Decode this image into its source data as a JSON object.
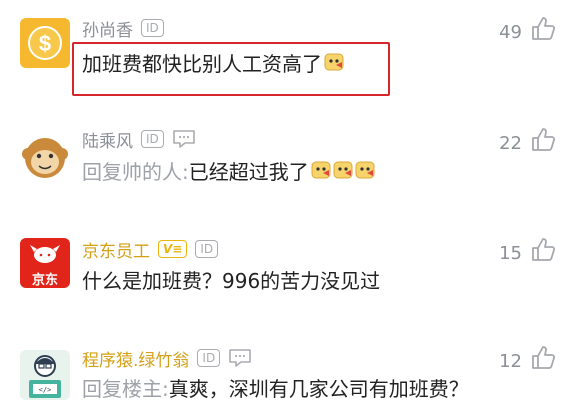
{
  "comments": [
    {
      "username": "孙尚香",
      "id_badge": "ID",
      "text": "加班费都快比别人工资高了",
      "emoji_count": 1,
      "likes": "49",
      "avatar": "dollar-coin-avatar"
    },
    {
      "username": "陆乘风",
      "id_badge": "ID",
      "reply_prefix": "回复帅的人:",
      "text": "已经超过我了",
      "emoji_count": 3,
      "likes": "22",
      "avatar": "monkey-avatar"
    },
    {
      "username": "京东员工",
      "id_badge": "ID",
      "vip_badge": "V≡",
      "text": "什么是加班费？996的苦力没见过",
      "likes": "15",
      "avatar": "jd-logo-avatar",
      "avatar_text": "京东"
    },
    {
      "username": "程序猿.绿竹翁",
      "id_badge": "ID",
      "reply_prefix": "回复楼主:",
      "text": "真爽，深圳有几家公司有加班费？",
      "likes": "12",
      "avatar": "programmer-avatar"
    }
  ],
  "colors": {
    "highlight_box": "#d6262b",
    "gold_username": "#d4a017",
    "jd_red": "#e1251b"
  }
}
